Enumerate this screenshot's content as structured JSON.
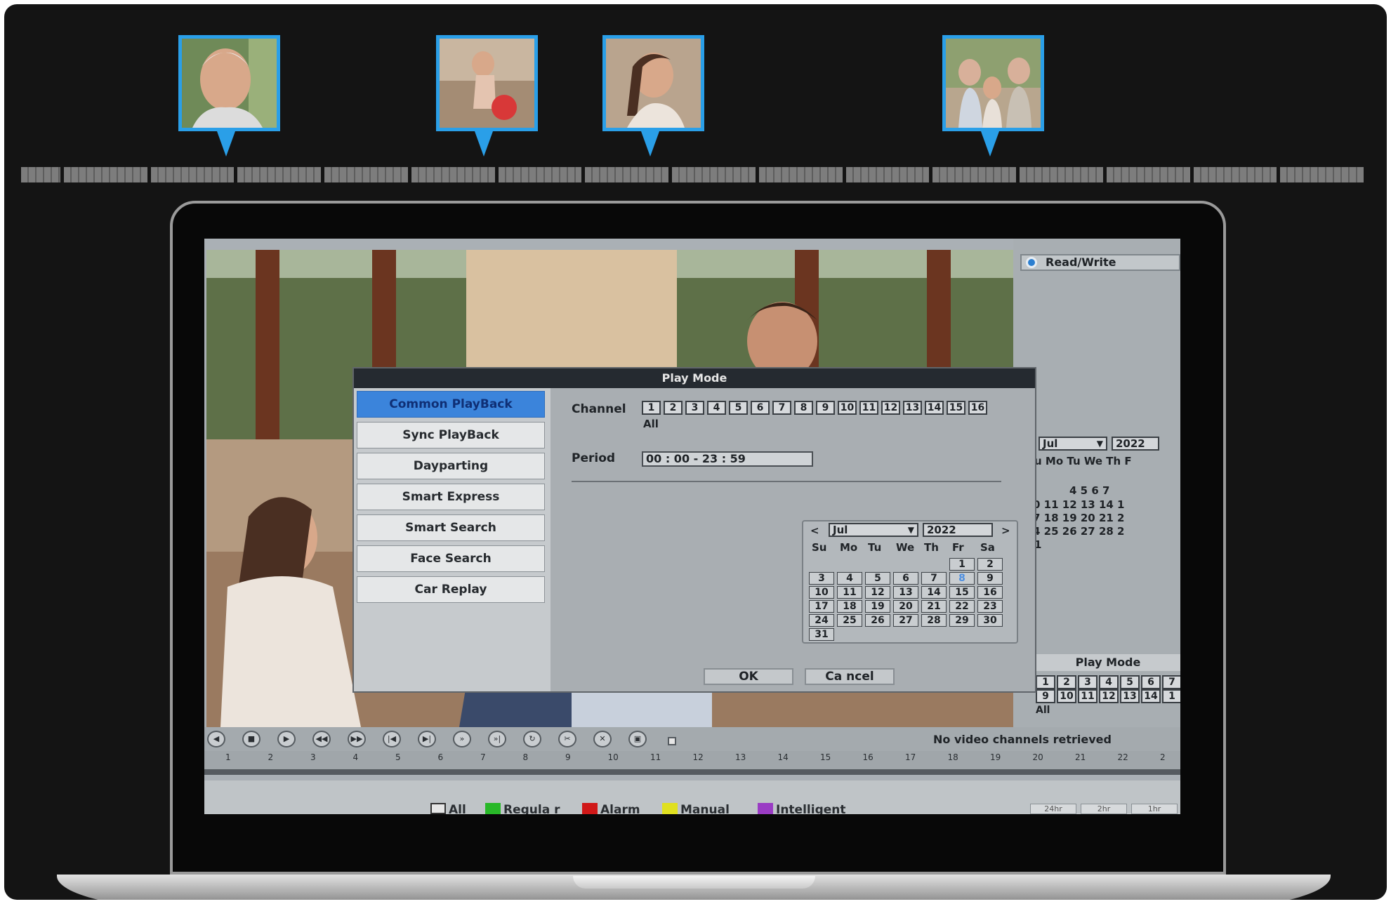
{
  "top_timeline": {
    "thumbnails": [
      {
        "name": "elderly-man"
      },
      {
        "name": "child-with-ball"
      },
      {
        "name": "girl-profile"
      },
      {
        "name": "family-group"
      }
    ]
  },
  "side_panel": {
    "read_write": "Read/Write",
    "cal_month": "Jul",
    "cal_year": "2022",
    "weekdays": "u Mo Tu We Th F",
    "rows": [
      "4 5 6 7",
      "0 11 12 13 14 1",
      "7 18 19 20 21 2",
      "4 25 26 27 28 2",
      "1"
    ],
    "play_mode_label": "Play Mode",
    "channels_row1": [
      "1",
      "2",
      "3",
      "4",
      "5",
      "6",
      "7"
    ],
    "channels_row2": [
      "9",
      "10",
      "11",
      "12",
      "13",
      "14",
      "1"
    ],
    "all_label": "All"
  },
  "dialog": {
    "title": "Play Mode",
    "modes": [
      {
        "label": "Common PlayBack",
        "selected": true
      },
      {
        "label": "Sync PlayBack",
        "selected": false
      },
      {
        "label": "Dayparting",
        "selected": false
      },
      {
        "label": "Smart Express",
        "selected": false
      },
      {
        "label": "Smart Search",
        "selected": false
      },
      {
        "label": "Face Search",
        "selected": false
      },
      {
        "label": "Car Replay",
        "selected": false
      }
    ],
    "channel_label": "Channel",
    "channels": [
      "1",
      "2",
      "3",
      "4",
      "5",
      "6",
      "7",
      "8",
      "9",
      "10",
      "11",
      "12",
      "13",
      "14",
      "15",
      "16"
    ],
    "channel_all": "All",
    "period_label": "Period",
    "period_value": "00 : 00     -     23 : 59",
    "calendar": {
      "prev": "<",
      "next": ">",
      "month": "Jul",
      "year": "2022",
      "weekdays": [
        "Su",
        "Mo",
        "Tu",
        "We",
        "Th",
        "Fr",
        "Sa"
      ],
      "today": "8",
      "days": [
        "1",
        "2",
        "3",
        "4",
        "5",
        "6",
        "7",
        "8",
        "9",
        "10",
        "11",
        "12",
        "13",
        "14",
        "15",
        "16",
        "17",
        "18",
        "19",
        "20",
        "21",
        "22",
        "23",
        "24",
        "25",
        "26",
        "27",
        "28",
        "29",
        "30",
        "31"
      ]
    },
    "ok_label": "OK",
    "cancel_label": "Ca ncel"
  },
  "playback": {
    "status": "No video channels retrieved",
    "ticks": [
      "1",
      "2",
      "3",
      "4",
      "5",
      "6",
      "7",
      "8",
      "9",
      "10",
      "11",
      "12",
      "13",
      "14",
      "15",
      "16",
      "17",
      "18",
      "19",
      "20",
      "21",
      "22",
      "2"
    ],
    "legend": [
      {
        "label": "All",
        "color": "#e6e6e6"
      },
      {
        "label": "Regula r",
        "color": "#28b828"
      },
      {
        "label": "Alarm",
        "color": "#d01818"
      },
      {
        "label": "Manual",
        "color": "#e0e020"
      },
      {
        "label": "Intelligent",
        "color": "#9a3cc4"
      }
    ],
    "zoom": [
      "24hr",
      "2hr",
      "1hr"
    ]
  }
}
